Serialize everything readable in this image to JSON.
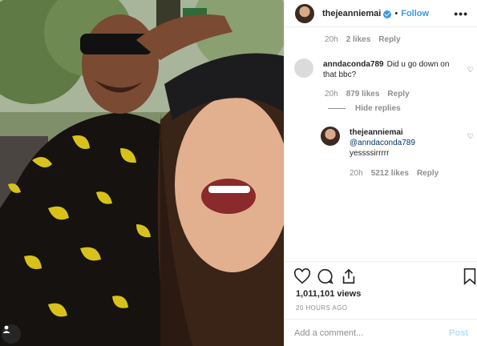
{
  "post": {
    "author": "thejeanniemai",
    "follow_label": "Follow",
    "more_label": "•••",
    "separator": "•"
  },
  "comments": [
    {
      "time": "20h",
      "likes": "2 likes",
      "reply": "Reply"
    },
    {
      "username": "anndaconda789",
      "text": "Did u go down on that bbc?",
      "time": "20h",
      "likes": "879 likes",
      "reply": "Reply",
      "hide_replies": "Hide replies"
    },
    {
      "username": "thejeanniemai",
      "mention": "@anndaconda789",
      "text": "yessssirrrrr",
      "time": "20h",
      "likes": "5212 likes",
      "reply": "Reply"
    }
  ],
  "stats": {
    "views": "1,011,101 views",
    "posted": "20 HOURS AGO"
  },
  "comment_input": {
    "placeholder": "Add a comment...",
    "post_label": "Post"
  },
  "icons": {
    "like": "heart-icon",
    "comment": "comment-icon",
    "share": "share-icon",
    "save": "bookmark-icon",
    "user_tag": "user-tag-icon"
  },
  "colors": {
    "accent": "#3897f0",
    "post_disabled": "#b2dffc",
    "secondary_text": "#8e8e8e"
  }
}
